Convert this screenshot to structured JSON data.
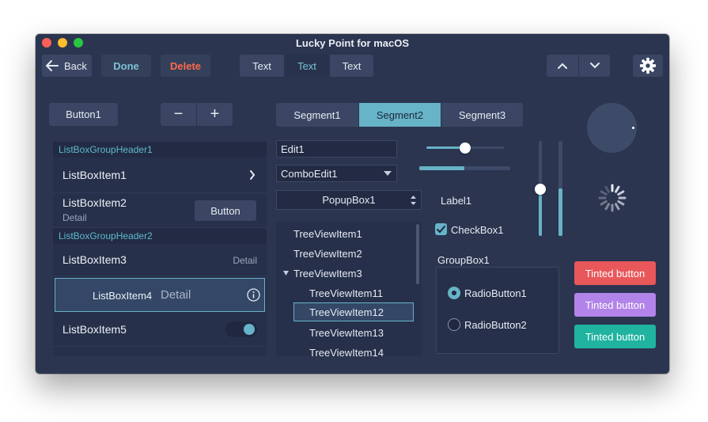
{
  "window": {
    "title": "Lucky Point for macOS"
  },
  "toolbar": {
    "back_label": "Back",
    "done_label": "Done",
    "delete_label": "Delete",
    "text_segments": [
      "Text",
      "Text",
      "Text"
    ],
    "selected_text_segment": 1
  },
  "row1": {
    "button1_label": "Button1",
    "minus_label": "−",
    "plus_label": "+",
    "segments": [
      "Segment1",
      "Segment2",
      "Segment3"
    ],
    "selected_segment": 1
  },
  "listbox": {
    "header1": "ListBoxGroupHeader1",
    "item1": "ListBoxItem1",
    "item2": "ListBoxItem2",
    "item2_detail": "Detail",
    "item2_button": "Button",
    "header2": "ListBoxGroupHeader2",
    "item3": "ListBoxItem3",
    "item3_detail": "Detail",
    "item4": "ListBoxItem4",
    "item4_detail": "Detail",
    "item5": "ListBoxItem5",
    "item5_toggle_on": true
  },
  "inputs": {
    "edit1": "Edit1",
    "combo_edit1": "ComboEdit1",
    "popup_box1": "PopupBox1"
  },
  "tree": {
    "items": [
      "TreeViewItem1",
      "TreeViewItem2",
      "TreeViewItem3"
    ],
    "children": [
      "TreeViewItem11",
      "TreeViewItem12",
      "TreeViewItem13",
      "TreeViewItem14"
    ],
    "selected": "TreeViewItem12"
  },
  "controls": {
    "slider1_value": 0.5,
    "progress_value": 0.5,
    "vslider_value": 0.45,
    "vprogress_value": 0.5,
    "label1": "Label1",
    "checkbox1_label": "CheckBox1",
    "checkbox1_checked": true,
    "groupbox1_title": "GroupBox1",
    "radio1_label": "RadioButton1",
    "radio2_label": "RadioButton2",
    "radio_selected": 1
  },
  "tinted_buttons": [
    {
      "label": "Tinted button",
      "color": "#e8575a"
    },
    {
      "label": "Tinted button",
      "color": "#b283e8"
    },
    {
      "label": "Tinted button",
      "color": "#1fb3a0"
    }
  ],
  "colors": {
    "accent": "#67b3c7",
    "delete": "#ff6a4d",
    "done": "#7cc0d6",
    "window_bg": "#2b3550"
  },
  "icons": [
    "back-arrow-icon",
    "chevron-up-icon",
    "chevron-down-icon",
    "gear-icon",
    "chevron-right-icon",
    "info-icon",
    "dropdown-arrow-icon",
    "updown-arrows-icon",
    "disclosure-triangle-icon",
    "spinner-icon",
    "checkmark-icon"
  ]
}
